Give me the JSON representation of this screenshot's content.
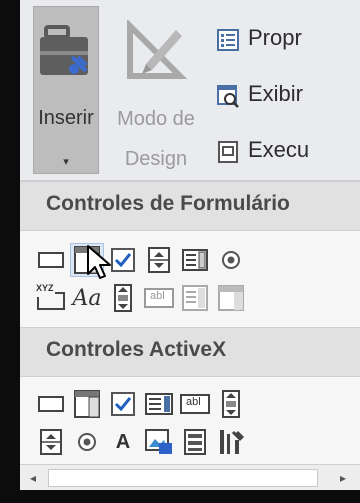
{
  "ribbon": {
    "insert_label_1": "Inserir",
    "insert_caret": "▾",
    "design_label_1": "Modo de",
    "design_label_2": "Design",
    "properties_label": "Propr",
    "view_code_label": "Exibir",
    "run_label": "Execu",
    "insert_icon": "toolbox-icon",
    "design_icon": "ruler-pencil-icon"
  },
  "panel": {
    "form_controls_header": "Controles de Formulário",
    "activex_header": "Controles ActiveX",
    "label_glyph": "Aa",
    "groupbox_glyph": "XYZ",
    "text_a_glyph": "A",
    "textfield_glyph": "abl"
  },
  "colors": {
    "accent_blue": "#2f62c9",
    "check_blue": "#1f5fbf"
  }
}
